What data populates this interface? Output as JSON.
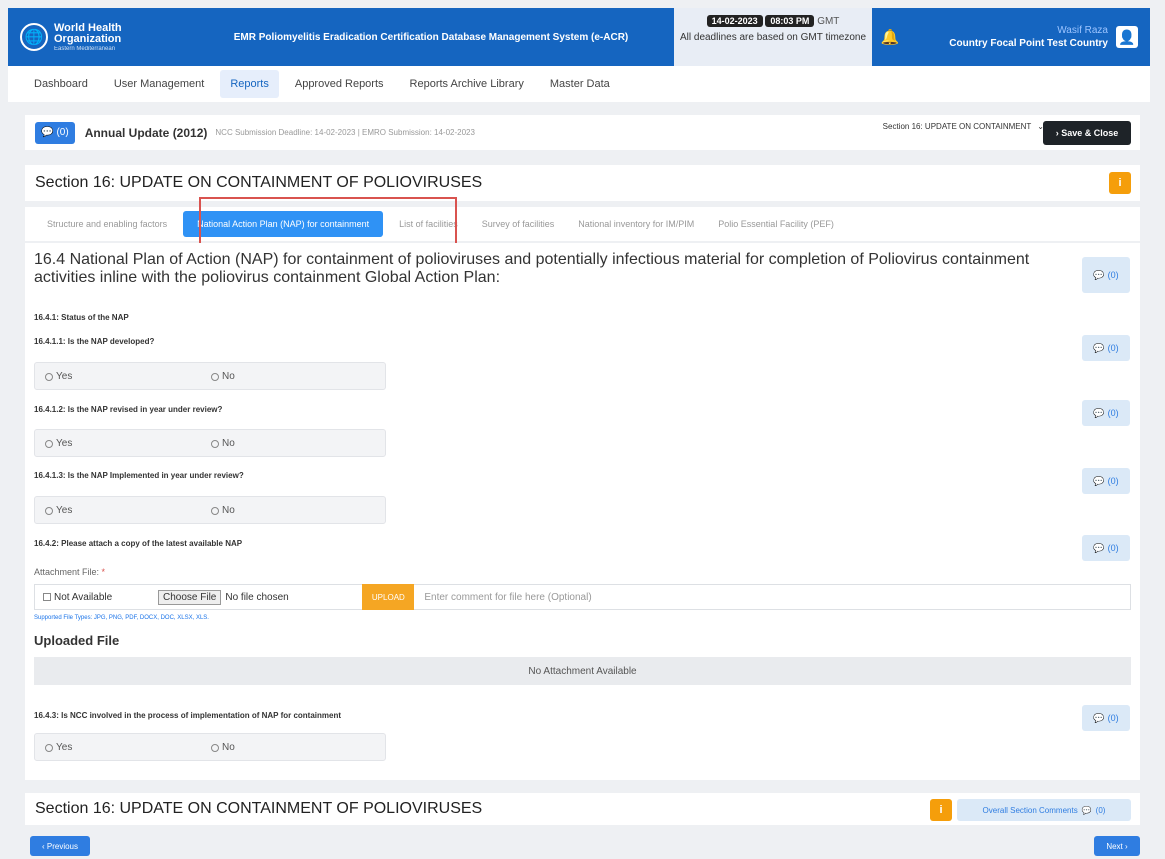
{
  "org": {
    "line1": "World Health",
    "line2": "Organization",
    "sub": "Eastern Mediterranean"
  },
  "system_title": "EMR Poliomyelitis Eradication Certification Database Management System (e-ACR)",
  "date": {
    "day": "14-02-2023",
    "time": "08:03 PM",
    "tz": "GMT",
    "note": "All deadlines are based on GMT timezone"
  },
  "user": {
    "name": "Wasif Raza",
    "role": "Country Focal Point Test Country"
  },
  "nav": [
    "Dashboard",
    "User Management",
    "Reports",
    "Approved Reports",
    "Reports Archive Library",
    "Master Data"
  ],
  "report": {
    "chat_count": "(0)",
    "title": "Annual Update (2012)",
    "deadline": "NCC Submission Deadline: 14-02-2023 | EMRO Submission: 14-02-2023",
    "section_select": "Section 16: UPDATE ON CONTAINMENT",
    "save_label": "Save & Close"
  },
  "section_title": "Section 16: UPDATE ON CONTAINMENT OF POLIOVIRUSES",
  "tabs": [
    "Structure and enabling factors",
    "National Action Plan (NAP) for containment",
    "List of facilities",
    "Survey of facilities",
    "National inventory for IM/PIM",
    "Polio Essential Facility (PEF)"
  ],
  "main_question": "16.4 National Plan of Action (NAP) for containment of polioviruses and potentially infectious material for completion of Poliovirus containment activities inline with the poliovirus containment Global Action Plan:",
  "status_heading": "16.4.1: Status of the NAP",
  "questions": [
    "16.4.1.1: Is the NAP developed?",
    "16.4.1.2: Is the NAP revised in year under review?",
    "16.4.1.3: Is the NAP Implemented in year under review?",
    "16.4.2: Please attach a copy of the latest available NAP",
    "16.4.3: Is NCC involved in the process of implementation of NAP for containment"
  ],
  "radio": {
    "yes": "Yes",
    "no": "No"
  },
  "comment_count": "(0)",
  "attachment": {
    "label": "Attachment File:",
    "required": "*",
    "not_available": "Not Available",
    "choose": "Choose File",
    "status": "No file chosen",
    "upload": "UPLOAD",
    "placeholder": "Enter comment for file here (Optional)",
    "supported": "Supported File Types: JPG, PNG, PDF, DOCX, DOC, XLSX, XLS."
  },
  "uploaded_heading": "Uploaded File",
  "no_attachment": "No Attachment Available",
  "footer": {
    "overall": "Overall Section Comments",
    "count": "(0)"
  },
  "buttons": {
    "prev": "Previous",
    "next": "Next"
  }
}
